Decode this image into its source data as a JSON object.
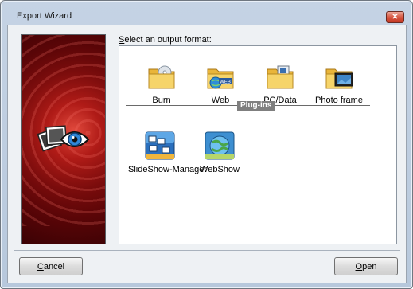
{
  "window": {
    "title": "Export Wizard"
  },
  "prompt": {
    "mnemonic": "S",
    "rest": "elect an output format:"
  },
  "formats": [
    {
      "label": "Burn",
      "icon": "folder-disc-icon"
    },
    {
      "label": "Web",
      "icon": "folder-web-icon",
      "badge": "WEB"
    },
    {
      "label": "PC/Data",
      "icon": "folder-pc-icon"
    },
    {
      "label": "Photo frame",
      "icon": "folder-photo-frame-icon"
    }
  ],
  "plugins_label": "Plug-ins",
  "plugins": [
    {
      "label": "SlideShow-Manager",
      "icon": "slideshow-manager-icon"
    },
    {
      "label": "WebShow",
      "icon": "webshow-icon"
    }
  ],
  "buttons": {
    "cancel": {
      "mnemonic": "C",
      "rest": "ancel"
    },
    "open": {
      "mnemonic": "O",
      "rest": "pen"
    }
  },
  "colors": {
    "accent_red": "#b01b17",
    "close_red": "#d5513c",
    "folder_yellow": "#f2c94c"
  }
}
